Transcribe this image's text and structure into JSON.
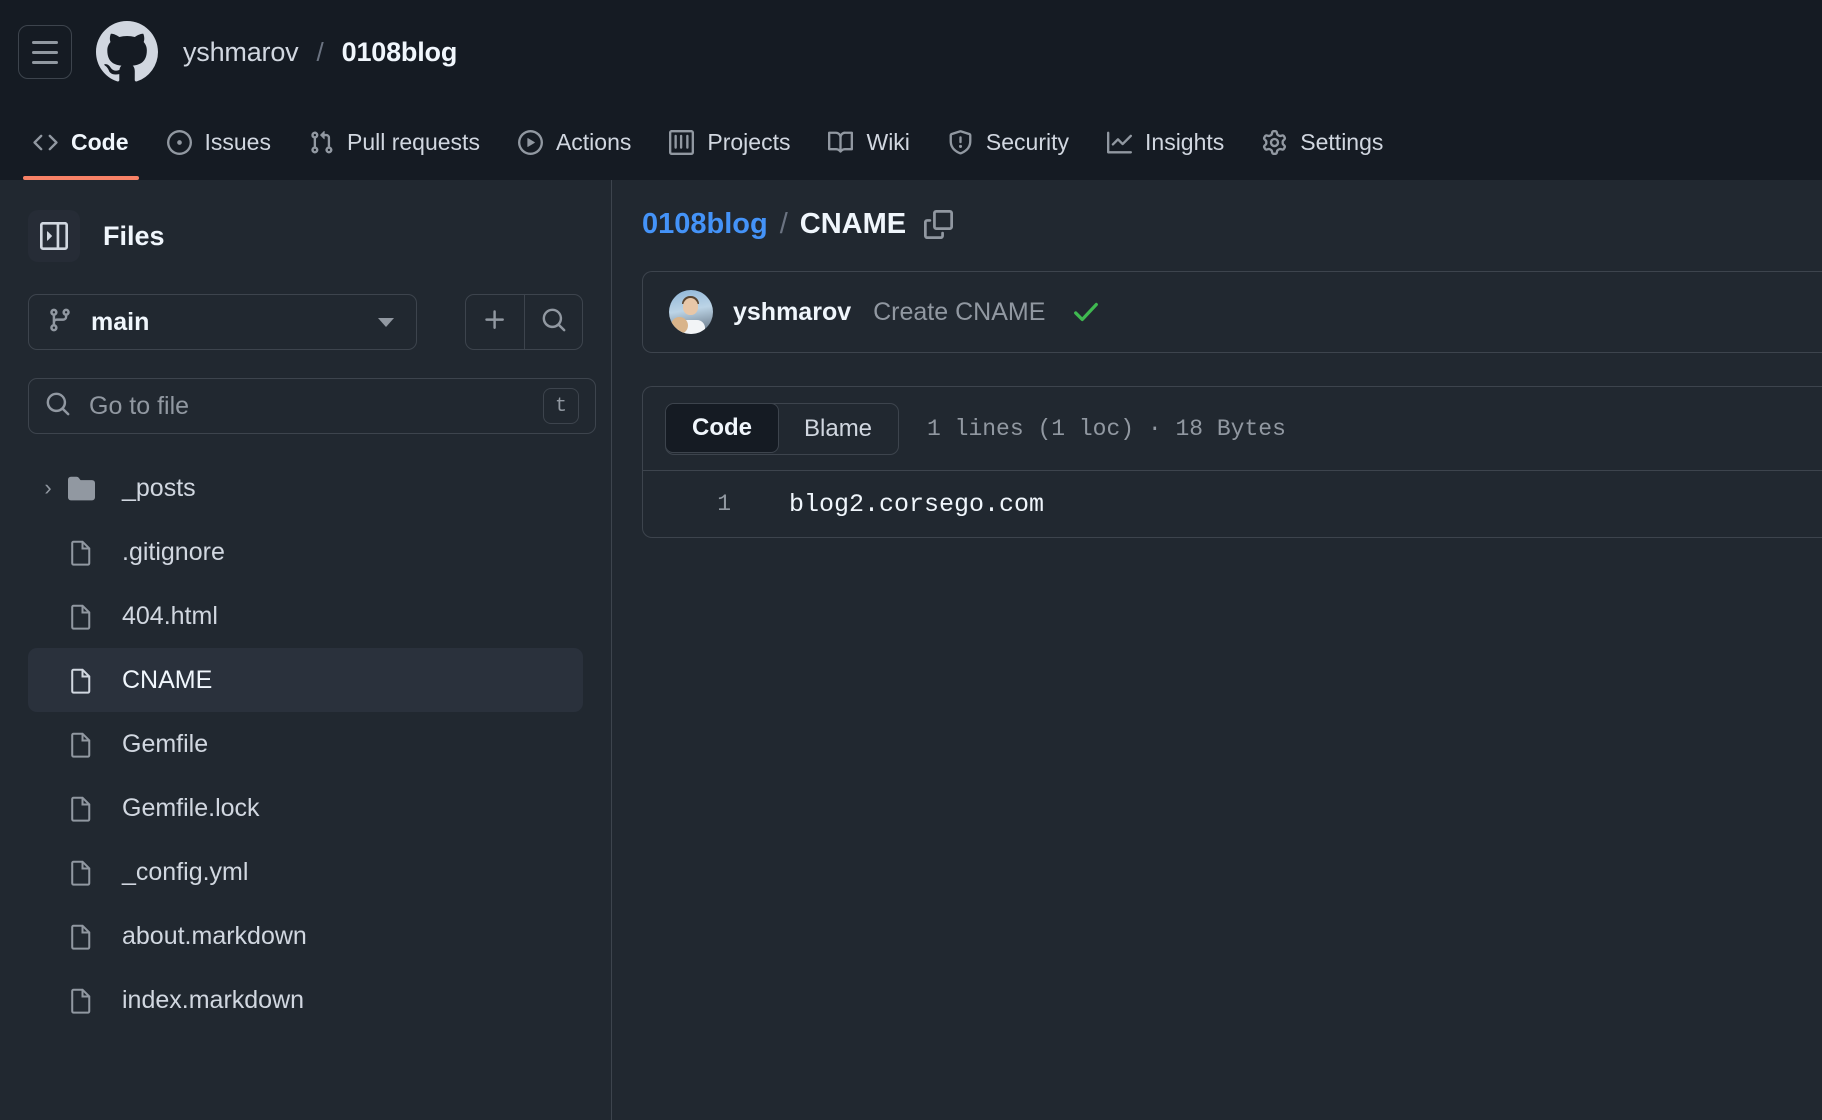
{
  "header": {
    "menu_icon": "hamburger-icon",
    "logo_icon": "github-logo-icon",
    "owner": "yshmarov",
    "separator": "/",
    "repo": "0108blog"
  },
  "nav": {
    "tabs": [
      {
        "label": "Code",
        "icon": "code-icon",
        "active": true
      },
      {
        "label": "Issues",
        "icon": "issue-opened-icon",
        "active": false
      },
      {
        "label": "Pull requests",
        "icon": "git-pull-request-icon",
        "active": false
      },
      {
        "label": "Actions",
        "icon": "play-icon",
        "active": false
      },
      {
        "label": "Projects",
        "icon": "table-icon",
        "active": false
      },
      {
        "label": "Wiki",
        "icon": "book-icon",
        "active": false
      },
      {
        "label": "Security",
        "icon": "shield-icon",
        "active": false
      },
      {
        "label": "Insights",
        "icon": "graph-icon",
        "active": false
      },
      {
        "label": "Settings",
        "icon": "gear-icon",
        "active": false
      }
    ],
    "active_underline_color": "#f78166"
  },
  "sidebar": {
    "panel_toggle_icon": "sidebar-collapse-icon",
    "title": "Files",
    "branch": {
      "icon": "git-branch-icon",
      "name": "main",
      "caret_icon": "chevron-down-icon"
    },
    "actions": [
      {
        "name": "add-file-button",
        "icon": "plus-icon"
      },
      {
        "name": "search-files-button",
        "icon": "search-icon"
      }
    ],
    "search": {
      "icon": "search-icon",
      "placeholder": "Go to file",
      "shortcut_key": "t"
    },
    "tree": [
      {
        "label": "_posts",
        "type": "folder",
        "expandable": true,
        "selected": false
      },
      {
        "label": ".gitignore",
        "type": "file",
        "expandable": false,
        "selected": false
      },
      {
        "label": "404.html",
        "type": "file",
        "expandable": false,
        "selected": false
      },
      {
        "label": "CNAME",
        "type": "file",
        "expandable": false,
        "selected": true
      },
      {
        "label": "Gemfile",
        "type": "file",
        "expandable": false,
        "selected": false
      },
      {
        "label": "Gemfile.lock",
        "type": "file",
        "expandable": false,
        "selected": false
      },
      {
        "label": "_config.yml",
        "type": "file",
        "expandable": false,
        "selected": false
      },
      {
        "label": "about.markdown",
        "type": "file",
        "expandable": false,
        "selected": false
      },
      {
        "label": "index.markdown",
        "type": "file",
        "expandable": false,
        "selected": false
      }
    ]
  },
  "main": {
    "breadcrumb": {
      "repo": "0108blog",
      "separator": "/",
      "file": "CNAME",
      "copy_icon": "copy-path-icon"
    },
    "commit": {
      "avatar_icon": "user-avatar",
      "author": "yshmarov",
      "message": "Create CNAME",
      "status_icon": "check-success-icon",
      "status_color": "#3fb950"
    },
    "code_panel": {
      "tabs": [
        {
          "label": "Code",
          "active": true
        },
        {
          "label": "Blame",
          "active": false
        }
      ],
      "file_meta": "1 lines (1 loc) · 18 Bytes",
      "lines": [
        {
          "number": "1",
          "content": "blog2.corsego.com"
        }
      ]
    }
  },
  "colors": {
    "header_bg": "#151b23",
    "body_bg": "#212830",
    "border": "#3d444d",
    "accent_link": "#4493f8",
    "accent_underline": "#f78166",
    "success": "#3fb950",
    "text_primary": "#f0f6fc",
    "text_secondary": "#9198a1"
  }
}
